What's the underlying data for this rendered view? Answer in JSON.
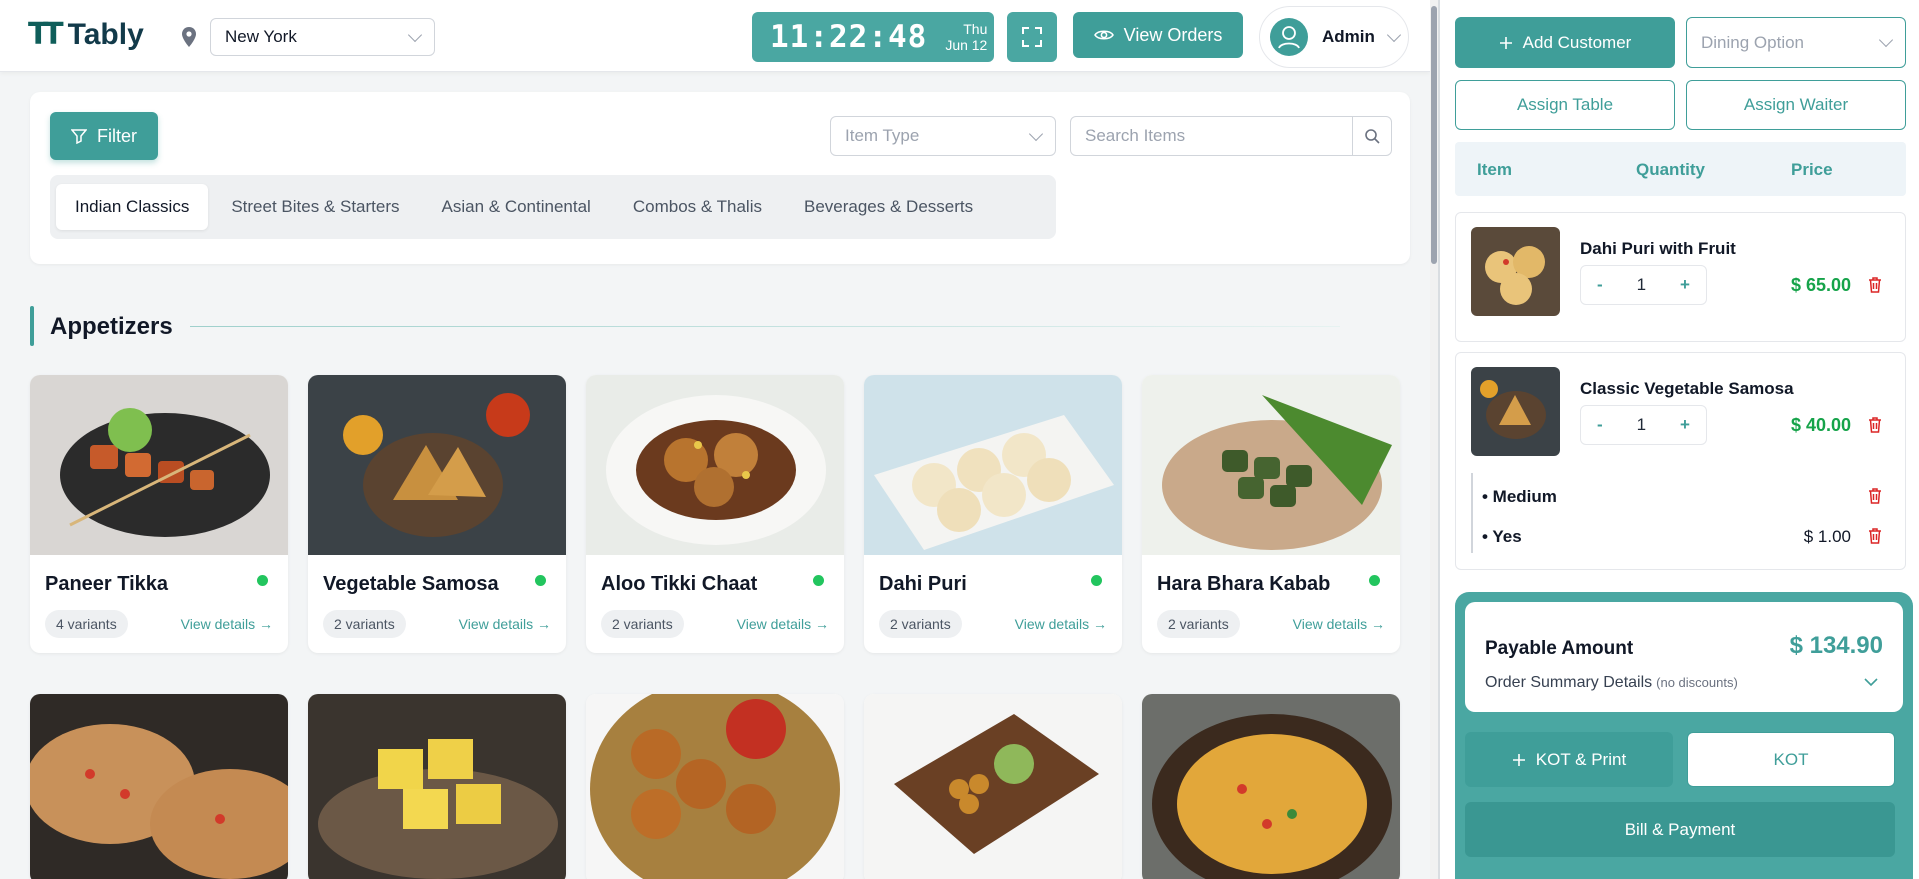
{
  "brand": {
    "name": "Tably",
    "mark": "TT"
  },
  "location": {
    "value": "New York"
  },
  "clock": {
    "time": "11:22:48",
    "day": "Thu",
    "date": "Jun 12"
  },
  "header": {
    "view_orders": "View Orders",
    "user": "Admin"
  },
  "filters": {
    "filter_label": "Filter",
    "item_type_placeholder": "Item Type",
    "search_placeholder": "Search Items",
    "tabs": [
      {
        "label": "Indian Classics",
        "active": true
      },
      {
        "label": "Street Bites & Starters",
        "active": false
      },
      {
        "label": "Asian & Continental",
        "active": false
      },
      {
        "label": "Combos & Thalis",
        "active": false
      },
      {
        "label": "Beverages & Desserts",
        "active": false
      }
    ]
  },
  "section": {
    "title": "Appetizers"
  },
  "items": [
    {
      "name": "Paneer Tikka",
      "variants": "4 variants",
      "link": "View details →",
      "veg": true
    },
    {
      "name": "Vegetable Samosa",
      "variants": "2 variants",
      "link": "View details →",
      "veg": true
    },
    {
      "name": "Aloo Tikki Chaat",
      "variants": "2 variants",
      "link": "View details →",
      "veg": true
    },
    {
      "name": "Dahi Puri",
      "variants": "2 variants",
      "link": "View details →",
      "veg": true
    },
    {
      "name": "Hara Bhara Kabab",
      "variants": "2 variants",
      "link": "View details →",
      "veg": true
    }
  ],
  "order_panel": {
    "add_customer": "Add Customer",
    "dining_placeholder": "Dining Option",
    "assign_table": "Assign Table",
    "assign_waiter": "Assign Waiter",
    "columns": {
      "item": "Item",
      "quantity": "Quantity",
      "price": "Price"
    },
    "lines": [
      {
        "name": "Dahi Puri with Fruit",
        "qty": "1",
        "price": "$ 65.00"
      },
      {
        "name": "Classic Vegetable Samosa",
        "qty": "1",
        "price": "$ 40.00",
        "addons": [
          {
            "label": "• Medium",
            "price": ""
          },
          {
            "label": "• Yes",
            "price": "$ 1.00"
          }
        ]
      }
    ],
    "minus": "-",
    "plus": "+",
    "payable_label": "Payable Amount",
    "payable_amount": "$ 134.90",
    "summary_label": "Order Summary Details",
    "summary_note": "(no discounts)",
    "kot_print": "KOT & Print",
    "kot": "KOT",
    "bill": "Bill & Payment"
  },
  "colors": {
    "accent": "#3f9e99",
    "price_green": "#16a34a",
    "veg_dot": "#22c55e",
    "delete_red": "#dc2626"
  }
}
